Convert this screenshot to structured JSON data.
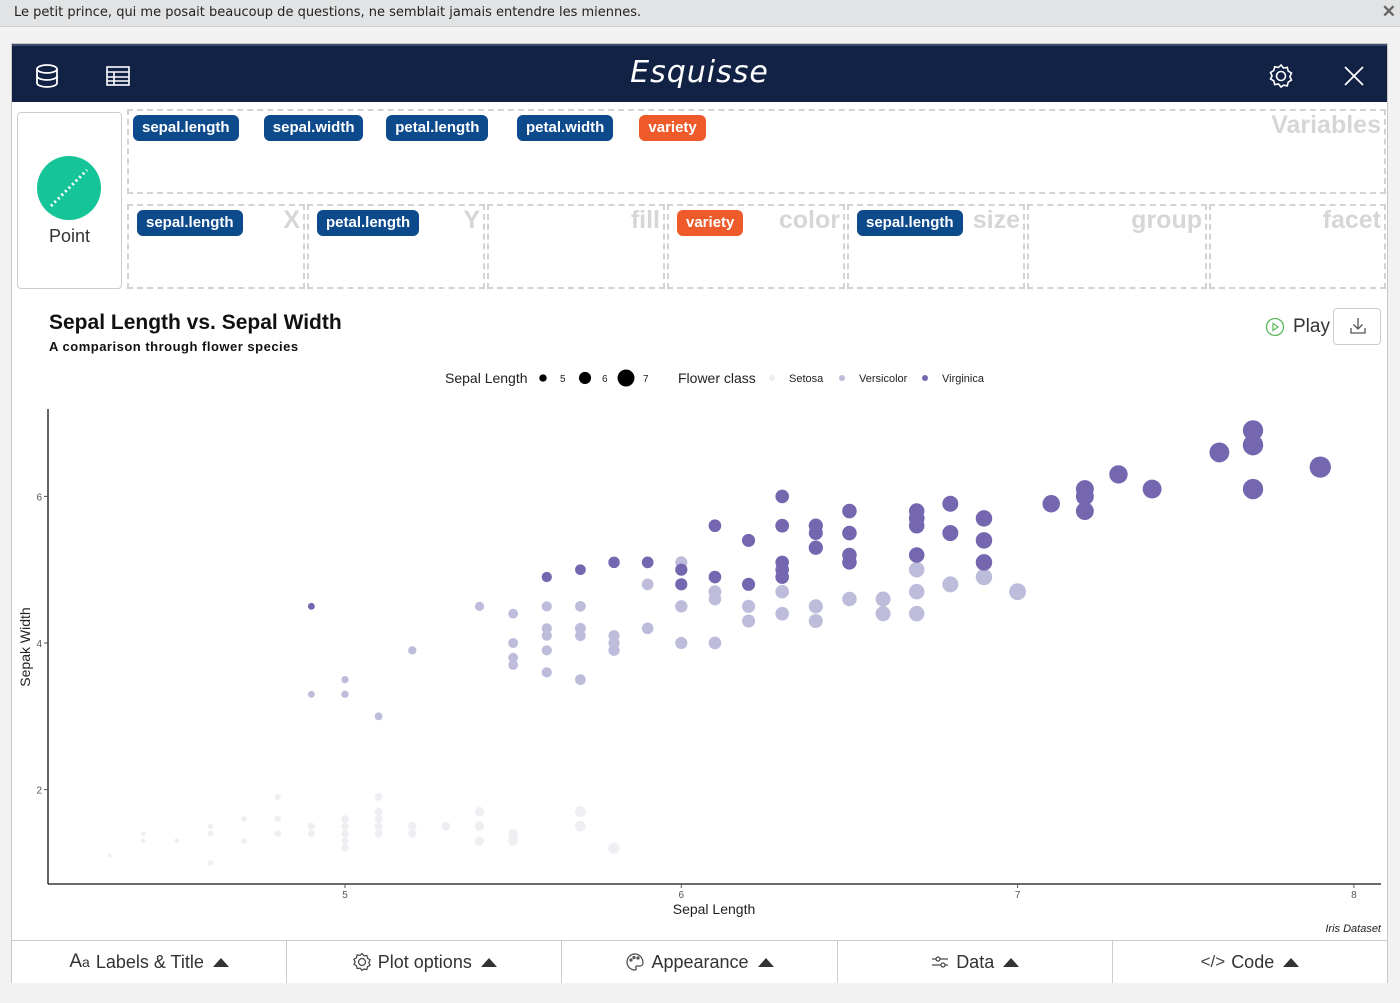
{
  "notification": {
    "message": "Le petit prince, qui me posait beaucoup de questions, ne semblait jamais entendre les miennes.",
    "close_icon": "close-icon"
  },
  "header": {
    "title": "Esquisse",
    "left_icons": [
      "database-icon",
      "table-icon"
    ],
    "right_icons": [
      "gear-icon",
      "close-icon"
    ]
  },
  "geom": {
    "label": "Point",
    "icon": "geom-point-icon"
  },
  "dropzones": {
    "variables": {
      "label": "Variables",
      "items": [
        {
          "name": "sepal.length",
          "type": "num"
        },
        {
          "name": "sepal.width",
          "type": "num"
        },
        {
          "name": "petal.length",
          "type": "num"
        },
        {
          "name": "petal.width",
          "type": "num"
        },
        {
          "name": "variety",
          "type": "cat"
        }
      ]
    },
    "x": {
      "label": "X",
      "items": [
        {
          "name": "sepal.length",
          "type": "num"
        }
      ]
    },
    "y": {
      "label": "Y",
      "items": [
        {
          "name": "petal.length",
          "type": "num"
        }
      ]
    },
    "fill": {
      "label": "fill",
      "items": []
    },
    "color": {
      "label": "color",
      "items": [
        {
          "name": "variety",
          "type": "cat"
        }
      ]
    },
    "size": {
      "label": "size",
      "items": [
        {
          "name": "sepal.length",
          "type": "num"
        }
      ]
    },
    "group": {
      "label": "group",
      "items": []
    },
    "facet": {
      "label": "facet",
      "items": []
    }
  },
  "colors": {
    "num_badge": "#0d4a8c",
    "cat_badge": "#ee5a2a",
    "header_bg": "#112245",
    "geom_point": "#16c597"
  },
  "plot": {
    "title": "Sepal Length vs. Sepal Width",
    "subtitle": "A comparison through flower species",
    "play_label": "Play",
    "download_icon": "download-icon"
  },
  "chart_data": {
    "type": "scatter",
    "title": "Sepal Length vs. Sepal Width",
    "subtitle": "A comparison through flower species",
    "xlabel": "Sepal Length",
    "ylabel": "Sepak Width",
    "caption": "Iris Dataset",
    "xlim": [
      4.25,
      8.1
    ],
    "ylim": [
      0.75,
      7.2
    ],
    "xticks": [
      5,
      6,
      7,
      8
    ],
    "yticks": [
      2,
      4,
      6
    ],
    "grid": false,
    "legend": {
      "position": "top",
      "size_title": "Sepal Length",
      "size_entries": [
        "5",
        "6",
        "7"
      ],
      "color_title": "Flower class",
      "color_entries": [
        {
          "label": "Setosa",
          "color": "#efeff3"
        },
        {
          "label": "Versicolor",
          "color": "#bebcdb"
        },
        {
          "label": "Virginica",
          "color": "#7566b0"
        }
      ]
    },
    "series": [
      {
        "name": "Setosa",
        "color": "#efeff3",
        "points": [
          [
            5.1,
            1.4
          ],
          [
            4.9,
            1.4
          ],
          [
            4.7,
            1.3
          ],
          [
            4.6,
            1.5
          ],
          [
            5.0,
            1.4
          ],
          [
            5.4,
            1.7
          ],
          [
            4.6,
            1.4
          ],
          [
            5.0,
            1.5
          ],
          [
            4.4,
            1.4
          ],
          [
            4.9,
            1.5
          ],
          [
            5.4,
            1.5
          ],
          [
            4.8,
            1.6
          ],
          [
            4.8,
            1.4
          ],
          [
            4.3,
            1.1
          ],
          [
            5.8,
            1.2
          ],
          [
            5.7,
            1.5
          ],
          [
            5.4,
            1.3
          ],
          [
            5.1,
            1.4
          ],
          [
            5.7,
            1.7
          ],
          [
            5.1,
            1.5
          ],
          [
            5.4,
            1.7
          ],
          [
            5.1,
            1.5
          ],
          [
            4.6,
            1.0
          ],
          [
            5.1,
            1.7
          ],
          [
            4.8,
            1.9
          ],
          [
            5.0,
            1.6
          ],
          [
            5.0,
            1.6
          ],
          [
            5.2,
            1.5
          ],
          [
            5.2,
            1.4
          ],
          [
            4.7,
            1.6
          ],
          [
            4.8,
            1.6
          ],
          [
            5.4,
            1.5
          ],
          [
            5.2,
            1.5
          ],
          [
            5.5,
            1.4
          ],
          [
            4.9,
            1.5
          ],
          [
            5.0,
            1.2
          ],
          [
            5.5,
            1.3
          ],
          [
            4.9,
            1.4
          ],
          [
            4.4,
            1.3
          ],
          [
            5.1,
            1.5
          ],
          [
            5.0,
            1.3
          ],
          [
            4.5,
            1.3
          ],
          [
            4.4,
            1.3
          ],
          [
            5.0,
            1.6
          ],
          [
            5.1,
            1.9
          ],
          [
            4.8,
            1.4
          ],
          [
            5.1,
            1.6
          ],
          [
            4.6,
            1.4
          ],
          [
            5.3,
            1.5
          ],
          [
            5.0,
            1.4
          ]
        ]
      },
      {
        "name": "Versicolor",
        "color": "#bebcdb",
        "points": [
          [
            7.0,
            4.7
          ],
          [
            6.4,
            4.5
          ],
          [
            6.9,
            4.9
          ],
          [
            5.5,
            4.0
          ],
          [
            6.5,
            4.6
          ],
          [
            5.7,
            4.5
          ],
          [
            6.3,
            4.7
          ],
          [
            4.9,
            3.3
          ],
          [
            6.6,
            4.6
          ],
          [
            5.2,
            3.9
          ],
          [
            5.0,
            3.5
          ],
          [
            5.9,
            4.2
          ],
          [
            6.0,
            4.0
          ],
          [
            6.1,
            4.7
          ],
          [
            5.6,
            3.6
          ],
          [
            6.7,
            4.4
          ],
          [
            5.6,
            4.5
          ],
          [
            5.8,
            4.1
          ],
          [
            6.2,
            4.5
          ],
          [
            5.6,
            3.9
          ],
          [
            5.9,
            4.8
          ],
          [
            6.1,
            4.0
          ],
          [
            6.3,
            4.9
          ],
          [
            6.1,
            4.7
          ],
          [
            6.4,
            4.3
          ],
          [
            6.6,
            4.4
          ],
          [
            6.8,
            4.8
          ],
          [
            6.7,
            5.0
          ],
          [
            6.0,
            4.5
          ],
          [
            5.7,
            3.5
          ],
          [
            5.5,
            3.8
          ],
          [
            5.5,
            3.7
          ],
          [
            5.8,
            3.9
          ],
          [
            6.0,
            5.1
          ],
          [
            5.4,
            4.5
          ],
          [
            6.0,
            4.5
          ],
          [
            6.7,
            4.7
          ],
          [
            6.3,
            4.4
          ],
          [
            5.6,
            4.1
          ],
          [
            5.5,
            4.0
          ],
          [
            5.5,
            4.4
          ],
          [
            6.1,
            4.6
          ],
          [
            5.8,
            4.0
          ],
          [
            5.0,
            3.3
          ],
          [
            5.6,
            4.2
          ],
          [
            5.7,
            4.2
          ],
          [
            5.7,
            4.2
          ],
          [
            6.2,
            4.3
          ],
          [
            5.1,
            3.0
          ],
          [
            5.7,
            4.1
          ]
        ]
      },
      {
        "name": "Virginica",
        "color": "#7566b0",
        "points": [
          [
            6.3,
            6.0
          ],
          [
            5.8,
            5.1
          ],
          [
            7.1,
            5.9
          ],
          [
            6.3,
            5.6
          ],
          [
            6.5,
            5.8
          ],
          [
            7.6,
            6.6
          ],
          [
            4.9,
            4.5
          ],
          [
            7.3,
            6.3
          ],
          [
            6.7,
            5.8
          ],
          [
            7.2,
            6.1
          ],
          [
            6.5,
            5.1
          ],
          [
            6.4,
            5.3
          ],
          [
            6.8,
            5.5
          ],
          [
            5.7,
            5.0
          ],
          [
            5.8,
            5.1
          ],
          [
            6.4,
            5.3
          ],
          [
            6.5,
            5.5
          ],
          [
            7.7,
            6.7
          ],
          [
            7.7,
            6.9
          ],
          [
            6.0,
            5.0
          ],
          [
            6.9,
            5.7
          ],
          [
            5.6,
            4.9
          ],
          [
            7.7,
            6.7
          ],
          [
            6.3,
            4.9
          ],
          [
            6.7,
            5.7
          ],
          [
            7.2,
            6.0
          ],
          [
            6.2,
            4.8
          ],
          [
            6.1,
            4.9
          ],
          [
            6.4,
            5.6
          ],
          [
            7.2,
            5.8
          ],
          [
            7.4,
            6.1
          ],
          [
            7.9,
            6.4
          ],
          [
            6.4,
            5.6
          ],
          [
            6.3,
            5.1
          ],
          [
            6.1,
            5.6
          ],
          [
            7.7,
            6.1
          ],
          [
            6.3,
            5.6
          ],
          [
            6.4,
            5.5
          ],
          [
            6.0,
            4.8
          ],
          [
            6.9,
            5.4
          ],
          [
            6.7,
            5.6
          ],
          [
            6.9,
            5.1
          ],
          [
            5.8,
            5.1
          ],
          [
            6.8,
            5.9
          ],
          [
            6.7,
            5.7
          ],
          [
            6.7,
            5.2
          ],
          [
            6.3,
            5.0
          ],
          [
            6.5,
            5.2
          ],
          [
            6.2,
            5.4
          ],
          [
            5.9,
            5.1
          ]
        ]
      }
    ]
  },
  "bottom_tabs": [
    {
      "label": "Labels & Title",
      "icon": "font-icon"
    },
    {
      "label": "Plot options",
      "icon": "gear-icon"
    },
    {
      "label": "Appearance",
      "icon": "palette-icon"
    },
    {
      "label": "Data",
      "icon": "sliders-icon"
    },
    {
      "label": "Code",
      "icon": "code-icon"
    }
  ]
}
